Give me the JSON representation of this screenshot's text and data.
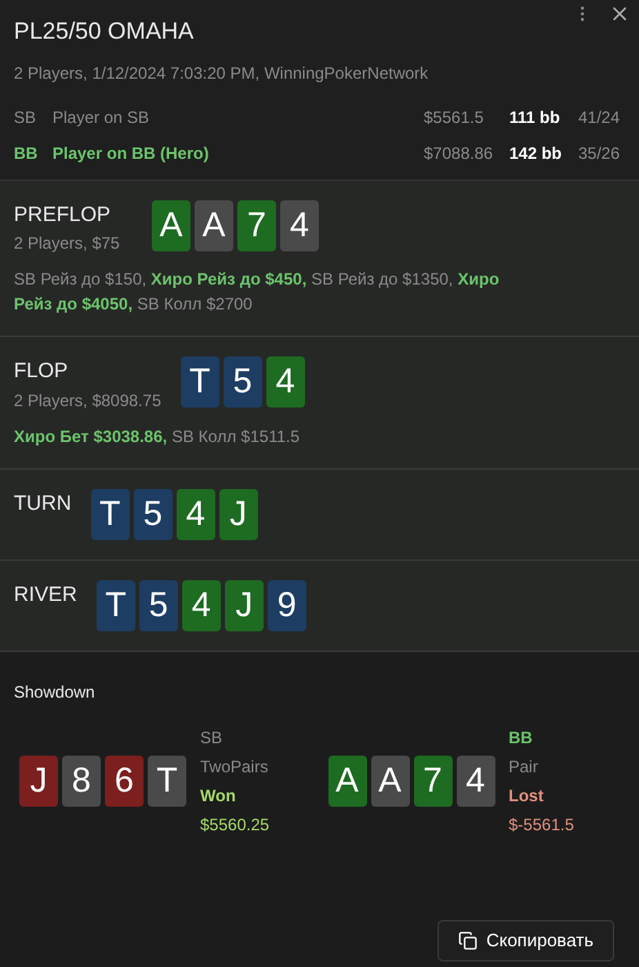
{
  "header": {
    "title": "PL25/50 OMAHA",
    "subtitle": "2 Players, 1/12/2024 7:03:20 PM, WinningPokerNetwork"
  },
  "players": [
    {
      "position": "SB",
      "name": "Player on SB",
      "stack": "$5561.5",
      "bb": "111 bb",
      "stat": "41/24",
      "hero": false
    },
    {
      "position": "BB",
      "name": "Player on BB (Hero)",
      "stack": "$7088.86",
      "bb": "142 bb",
      "stat": "35/26",
      "hero": true
    }
  ],
  "streets": [
    {
      "name": "PREFLOP",
      "info": "2 Players, $75",
      "cards": [
        {
          "rank": "A",
          "color": "#1e6b22"
        },
        {
          "rank": "A",
          "color": "#4a4a4a"
        },
        {
          "rank": "7",
          "color": "#1e6b22"
        },
        {
          "rank": "4",
          "color": "#4a4a4a"
        }
      ],
      "actions": [
        {
          "text": "SB Рейз до $150,",
          "hero": false
        },
        {
          "text": "Хиро Рейз до $450,",
          "hero": true
        },
        {
          "text": "SB Рейз до $1350,",
          "hero": false
        },
        {
          "text": "Хиро Рейз до $4050,",
          "hero": true
        },
        {
          "text": "SB Колл $2700",
          "hero": false
        }
      ]
    },
    {
      "name": "FLOP",
      "info": "2 Players, $8098.75",
      "cards": [
        {
          "rank": "T",
          "color": "#1d3d63"
        },
        {
          "rank": "5",
          "color": "#1d3d63"
        },
        {
          "rank": "4",
          "color": "#1e6b22"
        }
      ],
      "actions": [
        {
          "text": "Хиро Бет $3038.86,",
          "hero": true
        },
        {
          "text": "SB Колл $1511.5",
          "hero": false
        }
      ]
    },
    {
      "name": "TURN",
      "cards": [
        {
          "rank": "T",
          "color": "#1d3d63"
        },
        {
          "rank": "5",
          "color": "#1d3d63"
        },
        {
          "rank": "4",
          "color": "#1e6b22"
        },
        {
          "rank": "J",
          "color": "#1e6b22"
        }
      ]
    },
    {
      "name": "RIVER",
      "cards": [
        {
          "rank": "T",
          "color": "#1d3d63"
        },
        {
          "rank": "5",
          "color": "#1d3d63"
        },
        {
          "rank": "4",
          "color": "#1e6b22"
        },
        {
          "rank": "J",
          "color": "#1e6b22"
        },
        {
          "rank": "9",
          "color": "#1d3d63"
        }
      ]
    }
  ],
  "showdown": {
    "title": "Showdown",
    "hands": [
      {
        "position": "SB",
        "hero": false,
        "hand": "TwoPairs",
        "won": true,
        "result": "Won",
        "amount": "$5560.25",
        "cards": [
          {
            "rank": "J",
            "color": "#7c1f1f"
          },
          {
            "rank": "8",
            "color": "#4a4a4a"
          },
          {
            "rank": "6",
            "color": "#7c1f1f"
          },
          {
            "rank": "T",
            "color": "#4a4a4a"
          }
        ]
      },
      {
        "position": "BB",
        "hero": true,
        "hand": "Pair",
        "won": false,
        "result": "Lost",
        "amount": "$-5561.5",
        "cards": [
          {
            "rank": "A",
            "color": "#1e6b22"
          },
          {
            "rank": "A",
            "color": "#4a4a4a"
          },
          {
            "rank": "7",
            "color": "#1e6b22"
          },
          {
            "rank": "4",
            "color": "#4a4a4a"
          }
        ]
      }
    ]
  },
  "copy_button": "Скопировать"
}
